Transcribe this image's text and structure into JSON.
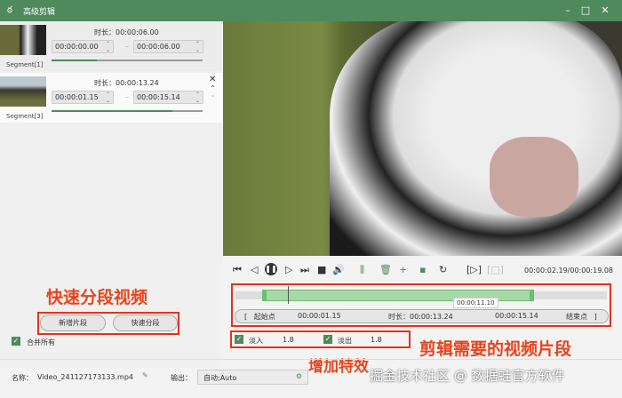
{
  "window": {
    "title": "高级剪辑",
    "icon": "rabbit-logo-icon",
    "accent": "#4e8a5c"
  },
  "segments": [
    {
      "label": "Segment[1]",
      "duration_label": "时长：",
      "duration": "00:00:06.00",
      "start": "00:00:00.00",
      "end": "00:00:06.00",
      "progress": 0.3
    },
    {
      "label": "Segment[3]",
      "duration_label": "时长：",
      "duration": "00:00:13.24",
      "start": "00:00:01.15",
      "end": "00:00:15.14",
      "progress": 0.8
    }
  ],
  "left_panel": {
    "annotation": "快速分段视频",
    "add_segment": "新增片段",
    "quick_split": "快速分段",
    "merge_all": "合并所有",
    "merge_checked": true
  },
  "player": {
    "time": "00:00:02.19/00:00:19.08"
  },
  "timeline": {
    "tooltip": "00:00:11.10",
    "start_btn": "起始点",
    "start": "00:00:01.15",
    "duration_label": "时长：",
    "duration": "00:00:13.24",
    "end": "00:00:15.14",
    "end_btn": "结束点"
  },
  "effects": {
    "fade_in_label": "淡入",
    "fade_in": "1.8",
    "fade_out_label": "淡出",
    "fade_out": "1.8"
  },
  "annotations": {
    "clip": "剪辑需要的视频片段",
    "effects": "增加特效",
    "watermark": "掘金技术社区 @ 数据蛙官方软件"
  },
  "bottom": {
    "name_label": "名称：",
    "name": "Video_241127173133.mp4",
    "output_label": "输出：",
    "output": "自动;Auto"
  }
}
